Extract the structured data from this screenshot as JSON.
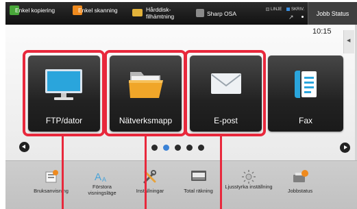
{
  "topbar": {
    "copy_label": "Enkel kopiering",
    "scan_label": "Enkel skanning",
    "hdd_label": "Hårddisk- filhämtning",
    "osa_label": "Sharp OSA",
    "light_linje": "LINJE",
    "light_skriv": "SKRIV.",
    "job_status": "Jobb Status"
  },
  "clock": "10:15",
  "tiles": [
    {
      "label": "FTP/dator",
      "icon": "monitor-icon"
    },
    {
      "label": "Nätverksmapp",
      "icon": "folder-icon"
    },
    {
      "label": "E-post",
      "icon": "envelope-icon"
    },
    {
      "label": "Fax",
      "icon": "fax-icon"
    }
  ],
  "pager": {
    "pages": 5,
    "active_page": 2
  },
  "bottombar": {
    "guide_label": "Bruksanvisning",
    "magnify_label": "Förstora visningsläge",
    "settings_label": "Inställningar",
    "counter_label": "Total räkning",
    "bright_label": "Ljusstyrka inställning",
    "job_label": "Jobbstatus"
  },
  "colors": {
    "highlight": "#e8283c",
    "pager_active": "#3b82d6",
    "tile_background": "#2a2a2a"
  }
}
